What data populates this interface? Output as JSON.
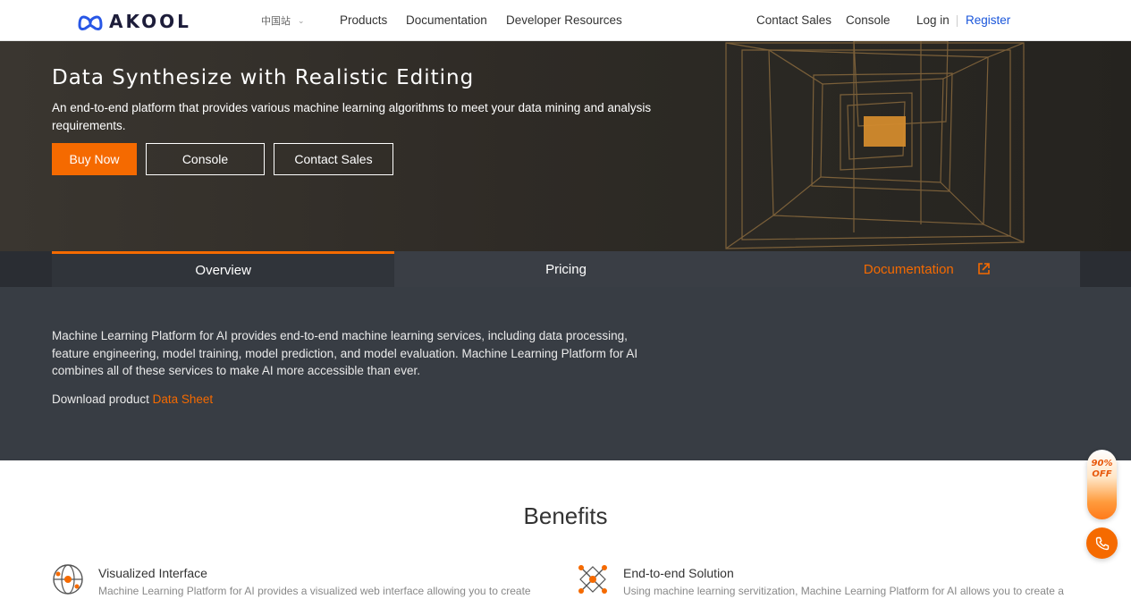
{
  "header": {
    "logo_text": "AKOOL",
    "region": "中国站",
    "nav": [
      "Products",
      "Documentation",
      "Developer Resources"
    ],
    "right": {
      "contact_sales": "Contact Sales",
      "console": "Console",
      "login": "Log in",
      "register": "Register"
    },
    "colors": {
      "register": "#1a56db"
    }
  },
  "hero": {
    "title": "Data Synthesize with Realistic Editing",
    "description": "An end-to-end platform that provides various machine learning algorithms to meet your data mining and analysis requirements.",
    "buttons": {
      "buy_now": "Buy Now",
      "console": "Console",
      "contact_sales": "Contact Sales"
    },
    "accent": "#f56a00"
  },
  "tabs": {
    "overview": "Overview",
    "pricing": "Pricing",
    "documentation": "Documentation"
  },
  "overview": {
    "text": "Machine Learning Platform for AI provides end-to-end machine learning services, including data processing, feature engineering, model training, model prediction, and model evaluation. Machine Learning Platform for AI combines all of these services to make AI more accessible than ever.",
    "download_prefix": "Download product ",
    "download_link": "Data Sheet"
  },
  "benefits": {
    "title": "Benefits",
    "items": [
      {
        "icon": "globe-target-icon",
        "title": "Visualized Interface",
        "desc": "Machine Learning Platform for AI provides a visualized web interface allowing you to create"
      },
      {
        "icon": "network-x-icon",
        "title": "End-to-end Solution",
        "desc": "Using machine learning servitization, Machine Learning Platform for AI allows you to create a"
      }
    ]
  },
  "widgets": {
    "promo_line1": "90%",
    "promo_line2": "OFF",
    "phone_icon": "phone-icon"
  }
}
